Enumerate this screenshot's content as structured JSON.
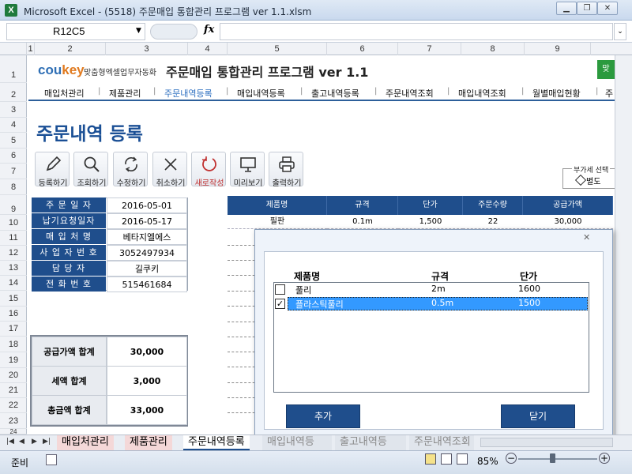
{
  "window": {
    "title": "Microsoft Excel - (5518) 주문매입 통합관리 프로그램 ver 1.1.xlsm",
    "app_icon": "X"
  },
  "formula_bar": {
    "name_box": "R12C5",
    "fx_label": "fx",
    "formula": ""
  },
  "column_headers": [
    "1",
    "2",
    "3",
    "4",
    "5",
    "6",
    "7",
    "8",
    "9"
  ],
  "row_headers": [
    "1",
    "2",
    "3",
    "4",
    "5",
    "6",
    "7",
    "8",
    "9",
    "10",
    "11",
    "12",
    "13",
    "14",
    "15",
    "16",
    "17",
    "18",
    "19",
    "20",
    "21",
    "22",
    "23",
    "24"
  ],
  "header": {
    "logo_main": "cou",
    "logo_accent": "key",
    "logo_sub": "맞춤형엑셀업무자동화",
    "title": "주문매입 통합관리 프로그램 ver 1.1",
    "green_button": "맞"
  },
  "nav": {
    "items": [
      "매입처관리",
      "제품관리",
      "주문내역등록",
      "매입내역등록",
      "출고내역등록",
      "주문내역조회",
      "매입내역조회",
      "월별매입현황",
      "주"
    ],
    "active": "주문내역등록"
  },
  "page_title": "주문내역 등록",
  "toolbar": {
    "register": "등록하기",
    "search": "조회하기",
    "modify": "수정하기",
    "cancel": "취소하기",
    "new": "새로작성",
    "preview": "미리보기",
    "print": "출력하기"
  },
  "tax": {
    "label": "부가세 선택",
    "option": "별도"
  },
  "form": [
    {
      "label": "주 문 일 자",
      "value": "2016-05-01"
    },
    {
      "label": "납기요청일자",
      "value": "2016-05-17"
    },
    {
      "label": "매 입 처 명",
      "value": "베타지엘에스"
    },
    {
      "label": "사 업 자 번 호",
      "value": "3052497934"
    },
    {
      "label": "담 당 자",
      "value": "길쿠키"
    },
    {
      "label": "전 화 번 호",
      "value": "515461684"
    }
  ],
  "summary": [
    {
      "label": "공급가액 합계",
      "value": "30,000"
    },
    {
      "label": "세액 합계",
      "value": "3,000"
    },
    {
      "label": "총금액 합계",
      "value": "33,000"
    }
  ],
  "order_table": {
    "headers": [
      "제품명",
      "규격",
      "단가",
      "주문수량",
      "공급가액"
    ],
    "rows": [
      [
        "필판",
        "0.1m",
        "1,500",
        "22",
        "30,000"
      ]
    ]
  },
  "dialog": {
    "headers": [
      "제품명",
      "규격",
      "단가"
    ],
    "rows": [
      {
        "checked": false,
        "name": "풀리",
        "spec": "2m",
        "price": "1600"
      },
      {
        "checked": true,
        "name": "플라스틱풀리",
        "spec": "0.5m",
        "price": "1500"
      }
    ],
    "add_button": "추가",
    "close_button": "닫기"
  },
  "sheet_tabs": [
    "매입처관리",
    "제품관리",
    "주문내역등록",
    "매입내역등",
    "출고내역등",
    "주문내역조회"
  ],
  "active_sheet": "주문내역등록",
  "status": {
    "ready": "준비",
    "zoom": "85%"
  },
  "colors": {
    "navy": "#1f4e8c",
    "accent_blue": "#2d6fc0",
    "selection": "#3399ff"
  }
}
